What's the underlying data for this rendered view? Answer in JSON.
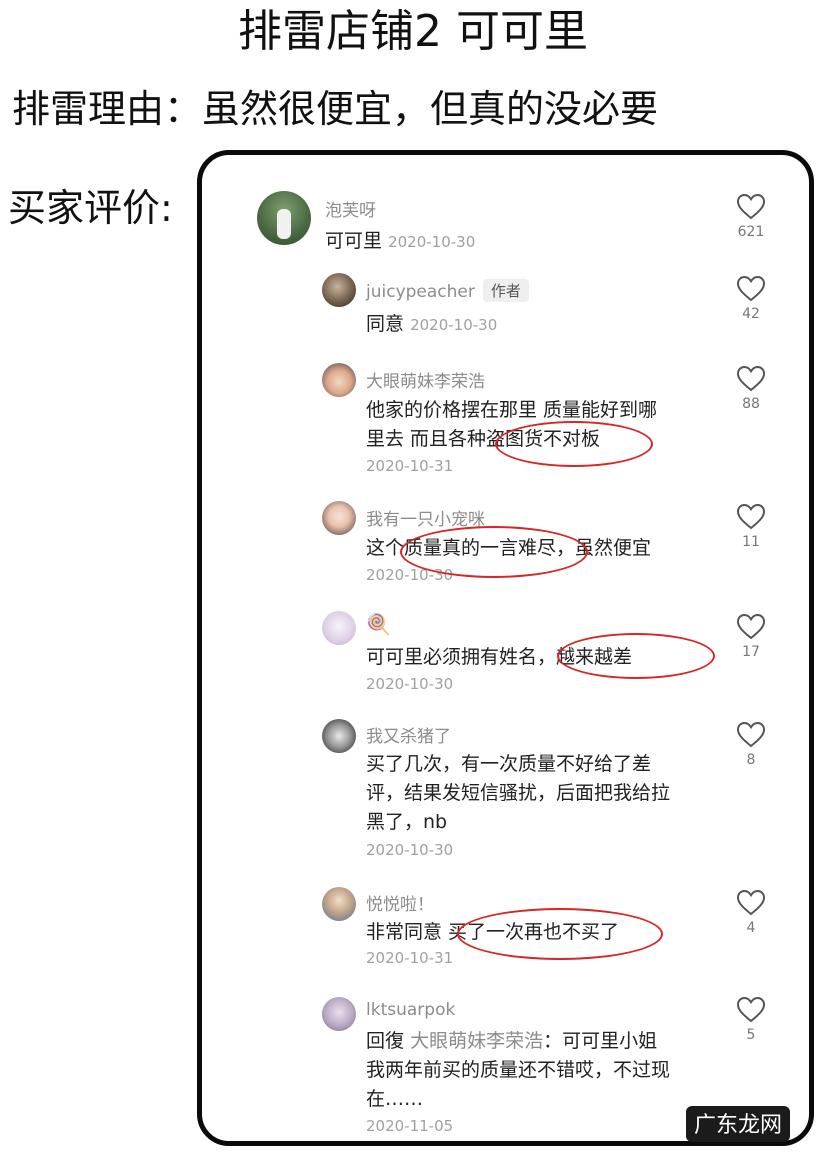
{
  "header": {
    "title": "排雷店铺2  可可里",
    "reason": "排雷理由：虽然很便宜，但真的没必要",
    "buyer_label": "买家评价:"
  },
  "comments": [
    {
      "name": "泡芙呀",
      "text": "可可里",
      "date": "2020-10-30",
      "likes": "621"
    },
    {
      "name": "juicypeacher",
      "tag": "作者",
      "text": "同意",
      "date": "2020-10-30",
      "likes": "42"
    },
    {
      "name": "大眼萌妹李荣浩",
      "line1": "他家的价格摆在那里 质量能好到哪",
      "line2": "里去 而且各种盗图货不对板",
      "date": "2020-10-31",
      "likes": "88"
    },
    {
      "name": "我有一只小宠咪",
      "text": "这个质量真的一言难尽，虽然便宜",
      "date": "2020-10-30",
      "likes": "11"
    },
    {
      "name": "🍭",
      "text": "可可里必须拥有姓名，越来越差",
      "date": "2020-10-30",
      "likes": "17"
    },
    {
      "name": "我又杀猪了",
      "line1": "买了几次，有一次质量不好给了差",
      "line2": "评，结果发短信骚扰，后面把我给拉",
      "line3": "黑了，nb",
      "date": "2020-10-30",
      "likes": "8"
    },
    {
      "name": "悦悦啦！",
      "text": "非常同意 买了一次再也不买了",
      "date": "2020-10-31",
      "likes": "4"
    },
    {
      "name": "lktsuarpok",
      "reply_prefix": "回復",
      "reply_to": "大眼萌妹李荣浩",
      "line1_rest": "：可可里小姐",
      "line2": "我两年前买的质量还不错哎，不过现",
      "line3": "在……",
      "date": "2020-11-05",
      "likes": "5"
    }
  ],
  "watermark": "广东龙网",
  "colors": {
    "highlight": "#d62626",
    "muted_text": "#8c8c8c",
    "frame": "#0a0a0a"
  },
  "icons": {
    "like": "heart-outline-icon"
  }
}
